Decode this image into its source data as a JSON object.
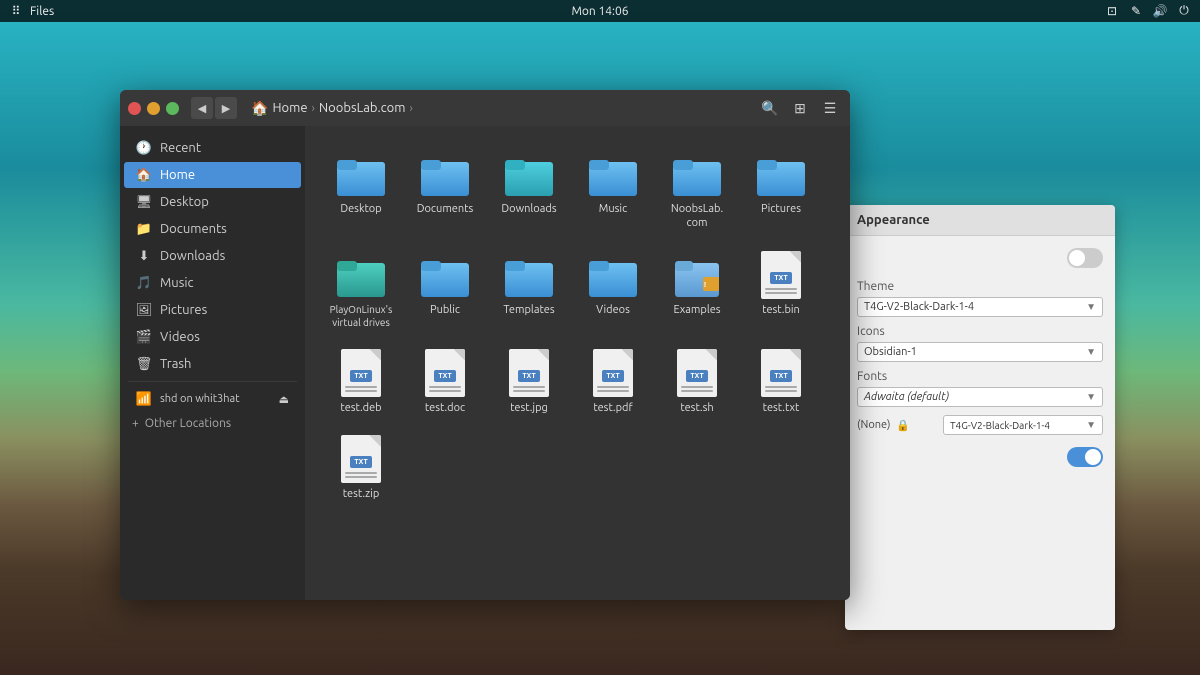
{
  "desktop": {
    "bg_colors": [
      "#2ab8c8",
      "#1a8c9c",
      "#4ab8a0",
      "#6db87a"
    ]
  },
  "top_panel": {
    "app_label": "...",
    "app_title": "Files",
    "clock": "Mon 14:06"
  },
  "files_window": {
    "title": "Files",
    "breadcrumb": {
      "home_label": "Home",
      "separator": ">",
      "current": "NoobsLab.com"
    },
    "sidebar": {
      "items": [
        {
          "id": "recent",
          "label": "Recent",
          "icon": "🕐"
        },
        {
          "id": "home",
          "label": "Home",
          "icon": "🏠",
          "active": true
        },
        {
          "id": "desktop",
          "label": "Desktop",
          "icon": "🖥"
        },
        {
          "id": "documents",
          "label": "Documents",
          "icon": "📁"
        },
        {
          "id": "downloads",
          "label": "Downloads",
          "icon": "⬇"
        },
        {
          "id": "music",
          "label": "Music",
          "icon": "🎵"
        },
        {
          "id": "pictures",
          "label": "Pictures",
          "icon": "🖼"
        },
        {
          "id": "videos",
          "label": "Videos",
          "icon": "🎬"
        },
        {
          "id": "trash",
          "label": "Trash",
          "icon": "🗑"
        },
        {
          "id": "network",
          "label": "shd on whit3hat",
          "icon": "📶"
        },
        {
          "id": "other",
          "label": "Other Locations",
          "icon": "+"
        }
      ]
    },
    "folders": [
      {
        "id": "desktop",
        "label": "Desktop",
        "color": "blue"
      },
      {
        "id": "documents",
        "label": "Documents",
        "color": "blue"
      },
      {
        "id": "downloads",
        "label": "Downloads",
        "color": "cyan"
      },
      {
        "id": "music",
        "label": "Music",
        "color": "blue"
      },
      {
        "id": "noobslab",
        "label": "NoobsLab.\ncom",
        "color": "blue"
      },
      {
        "id": "pictures",
        "label": "Pictures",
        "color": "blue"
      },
      {
        "id": "playonlinux",
        "label": "PlayOnLinux's virtual\ndrives",
        "color": "teal"
      },
      {
        "id": "public",
        "label": "Public",
        "color": "blue"
      },
      {
        "id": "templates",
        "label": "Templates",
        "color": "blue"
      },
      {
        "id": "videos",
        "label": "Videos",
        "color": "blue"
      }
    ],
    "files": [
      {
        "id": "examples",
        "label": "Examples",
        "type": "folder-special"
      },
      {
        "id": "test-bin",
        "label": "test.bin",
        "type": "txt"
      },
      {
        "id": "test-deb",
        "label": "test.deb",
        "type": "txt"
      },
      {
        "id": "test-doc",
        "label": "test.doc",
        "type": "txt"
      },
      {
        "id": "test-jpg",
        "label": "test.jpg",
        "type": "txt"
      },
      {
        "id": "test-pdf",
        "label": "test.pdf",
        "type": "txt"
      },
      {
        "id": "test-sh",
        "label": "test.sh",
        "type": "txt"
      },
      {
        "id": "test-txt",
        "label": "test.txt",
        "type": "txt"
      },
      {
        "id": "test-zip",
        "label": "test.zip",
        "type": "txt"
      }
    ]
  },
  "settings_panel": {
    "title": "Appearance",
    "theme_label": "Theme",
    "theme_value": "T4G-V2-Black-Dark-1-4",
    "icons_label": "Icons",
    "icons_value": "Obsidian-1",
    "fonts_label": "Fonts",
    "fonts_value": "Adwaita (default)",
    "cursor_label": "(None)",
    "cursor_value": "T4G-V2-Black-Dark-1-4",
    "toggle_off_label": "toggle-off",
    "toggle_on_label": "toggle-on"
  }
}
